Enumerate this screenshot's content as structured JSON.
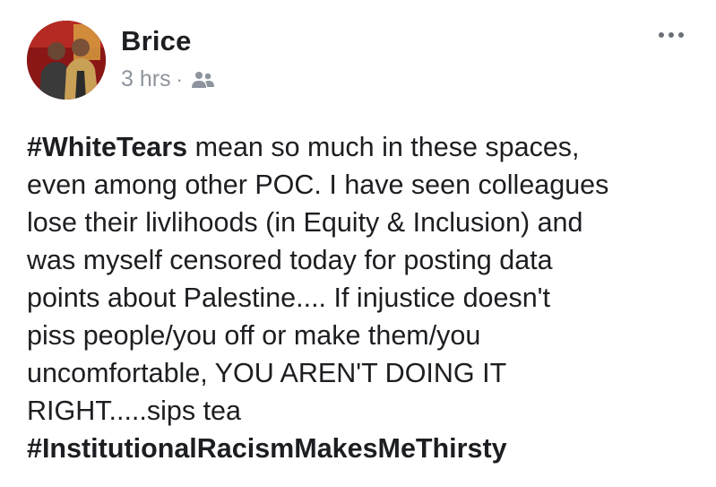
{
  "post": {
    "author": "Brice",
    "timestamp": "3 hrs",
    "separator": "·",
    "audience_icon": "friends-icon",
    "more_icon": "more-options-icon",
    "hashtag_opening": "#WhiteTears",
    "text_main": " mean so much in these spaces,\neven among other POC. I have seen colleagues\nlose their livlihoods (in Equity & Inclusion) and\nwas myself censored today for posting data\npoints about Palestine.... If injustice doesn't\npiss people/you off or make them/you\nuncomfortable, YOU AREN'T DOING IT\nRIGHT.....sips tea",
    "hashtag_closing": "#InstitutionalRacismMakesMeThirsty"
  },
  "colors": {
    "text": "#1c1e21",
    "meta": "#8d949e",
    "avatar_background": "#8a1616"
  }
}
